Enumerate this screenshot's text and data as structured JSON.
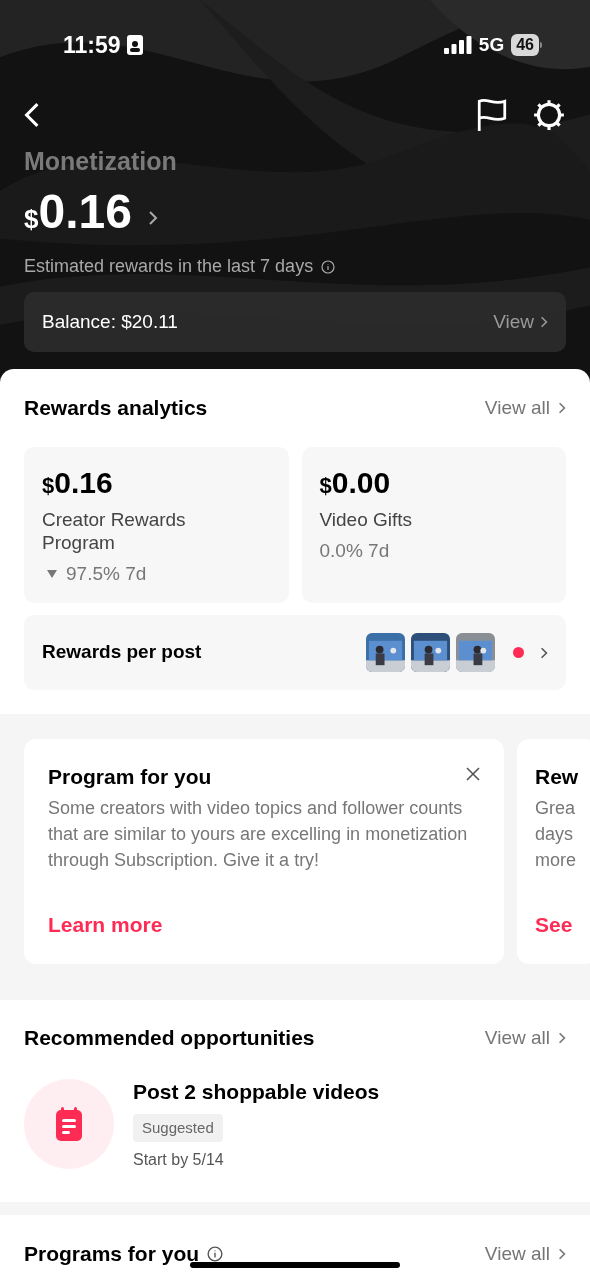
{
  "status_bar": {
    "time": "11:59",
    "network": "5G",
    "battery": "46"
  },
  "header": {
    "title": "Monetization",
    "currency": "$",
    "amount": "0.16",
    "subtitle": "Estimated rewards in the last 7 days",
    "balance": "Balance: $20.11",
    "balance_link": "View"
  },
  "rewards_analytics": {
    "title": "Rewards analytics",
    "link": "View all",
    "cards": [
      {
        "currency": "$",
        "amount": "0.16",
        "label": "Creator Rewards Program",
        "change": "97.5% 7d",
        "decline": true
      },
      {
        "currency": "$",
        "amount": "0.00",
        "label": "Video Gifts",
        "change": "0.0% 7d",
        "decline": false
      }
    ],
    "per_post": {
      "label": "Rewards per post",
      "unread": true
    }
  },
  "program_cards": [
    {
      "title": "Program for you",
      "body": "Some creators with video topics and follower counts that are similar to yours are excelling in monetization through Subscription. Give it a try!",
      "link": "Learn more",
      "closable": true
    },
    {
      "title": "Rew",
      "lines": [
        "Grea",
        "days",
        "more"
      ],
      "link": "See",
      "closable": false
    }
  ],
  "recommended": {
    "title": "Recommended opportunities",
    "link": "View all",
    "items": [
      {
        "title": "Post 2 shoppable videos",
        "tag": "Suggested",
        "due": "Start by 5/14"
      }
    ]
  },
  "programs": {
    "title": "Programs for you",
    "link": "View all"
  }
}
